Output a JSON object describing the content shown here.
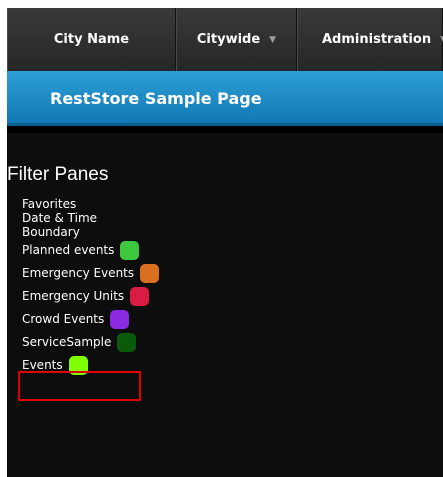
{
  "topnav": {
    "city_name": "City Name",
    "citywide": "Citywide",
    "administration": "Administration"
  },
  "banner": {
    "title": "RestStore Sample Page"
  },
  "filter_panes": {
    "heading": "Filter Panes",
    "items": [
      {
        "label": "Favorites"
      },
      {
        "label": "Date & Time"
      },
      {
        "label": "Boundary"
      },
      {
        "label": "Planned events",
        "color": "#3ec83e"
      },
      {
        "label": "Emergency Events",
        "color": "#d96f1f"
      },
      {
        "label": "Emergency Units",
        "color": "#d81c42"
      },
      {
        "label": "Crowd Events",
        "color": "#8a2be2"
      },
      {
        "label": "ServiceSample",
        "color": "#0a5a0a"
      },
      {
        "label": "Events",
        "color": "#7fff00"
      }
    ]
  },
  "colors": {
    "nav_bg": "#2e2e2e",
    "banner_bg": "#1a8cc8",
    "content_bg": "#0d0d0d",
    "highlight_border": "#e00000"
  }
}
